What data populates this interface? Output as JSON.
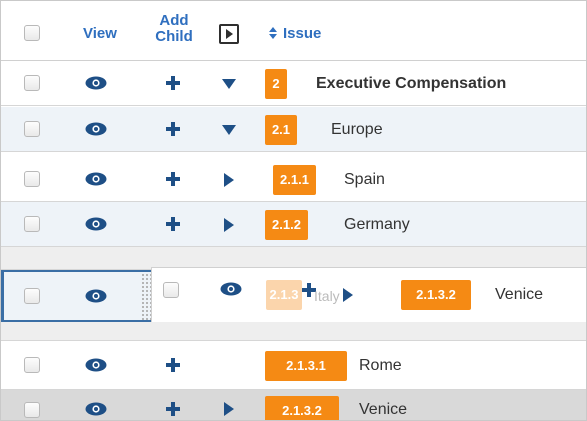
{
  "header": {
    "view_label": "View",
    "add_child_line1": "Add",
    "add_child_line2": "Child",
    "issue_label": "Issue"
  },
  "rows": [
    {
      "badge": "2",
      "label": "Executive Compensation",
      "expander": "down",
      "bold": true
    },
    {
      "badge": "2.1",
      "label": "Europe",
      "expander": "down",
      "bold": false
    },
    {
      "badge": "2.1.1",
      "label": "Spain",
      "expander": "right",
      "bold": false
    },
    {
      "badge": "2.1.2",
      "label": "Germany",
      "expander": "right",
      "bold": false
    }
  ],
  "drag": {
    "ghost_badge": "2.1.3",
    "ghost_label": "Italy",
    "badge": "2.1.3.2",
    "label": "Venice"
  },
  "lower_rows": [
    {
      "badge": "2.1.3.1",
      "label": "Rome"
    },
    {
      "badge": "2.1.3.2",
      "label": "Venice"
    }
  ],
  "colors": {
    "accent": "#2f6fbf",
    "icon": "#1e4f86",
    "badge": "#f58a14",
    "row_alt": "#eef3f8",
    "selected": "#d9d9d9",
    "drop_line": "#3a6ea5"
  },
  "icons": {
    "view": "eye-icon",
    "add_child": "plus-icon",
    "expand": "caret-down-icon",
    "collapsed": "caret-right-icon",
    "expand_all": "play-box-icon",
    "sort": "sort-icon",
    "drag_handle": "grip-icon"
  }
}
